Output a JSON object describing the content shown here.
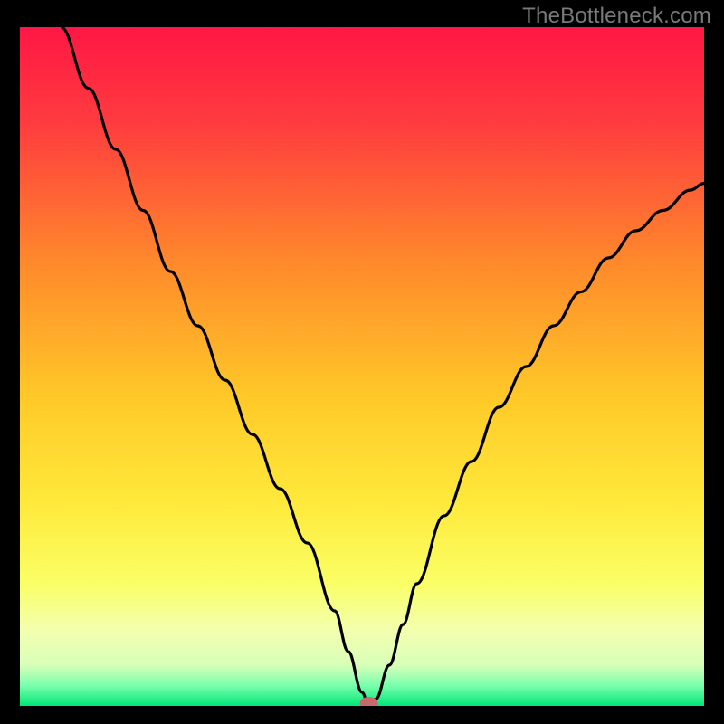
{
  "watermark": "TheBottleneck.com",
  "chart_data": {
    "type": "line",
    "title": "",
    "xlabel": "",
    "ylabel": "",
    "xlim": [
      0,
      100
    ],
    "ylim": [
      0,
      100
    ],
    "background_gradient": {
      "stops": [
        {
          "offset": 0,
          "color": "#ff1744"
        },
        {
          "offset": 14,
          "color": "#ff3b3f"
        },
        {
          "offset": 35,
          "color": "#ff8a2b"
        },
        {
          "offset": 55,
          "color": "#ffca28"
        },
        {
          "offset": 70,
          "color": "#ffe93b"
        },
        {
          "offset": 82,
          "color": "#faff66"
        },
        {
          "offset": 89,
          "color": "#f3ffb0"
        },
        {
          "offset": 94,
          "color": "#d8ffb8"
        },
        {
          "offset": 97,
          "color": "#7affad"
        },
        {
          "offset": 100,
          "color": "#00e676"
        }
      ]
    },
    "series": [
      {
        "name": "bottleneck-curve",
        "color": "#000000",
        "x": [
          6,
          10,
          14,
          18,
          22,
          26,
          30,
          34,
          38,
          42,
          46,
          48,
          50,
          51,
          52,
          54,
          56,
          58,
          62,
          66,
          70,
          74,
          78,
          82,
          86,
          90,
          94,
          98,
          100
        ],
        "y": [
          100,
          91,
          82,
          73,
          64,
          56,
          48,
          40,
          32,
          24,
          14,
          8,
          2,
          0,
          1,
          6,
          12,
          18,
          28,
          36,
          44,
          50,
          56,
          61,
          66,
          70,
          73,
          76,
          77
        ]
      }
    ],
    "marker": {
      "name": "min-point",
      "x": 51,
      "y": 0,
      "color": "#c96a6a",
      "rx": 10,
      "ry": 7
    }
  }
}
